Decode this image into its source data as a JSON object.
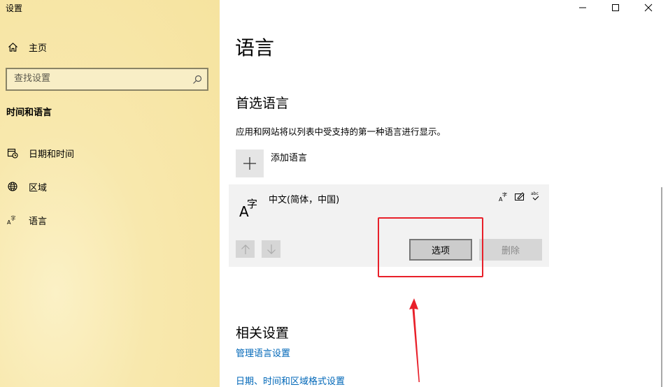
{
  "window": {
    "title": "设置",
    "controls": {
      "minimize": "—",
      "maximize": "☐",
      "close": "✕"
    }
  },
  "sidebar": {
    "home_label": "主页",
    "search_placeholder": "查找设置",
    "section_heading": "时间和语言",
    "items": [
      {
        "label": "日期和时间",
        "icon": "calendar-clock-icon"
      },
      {
        "label": "区域",
        "icon": "globe-icon"
      },
      {
        "label": "语言",
        "icon": "language-icon"
      }
    ]
  },
  "main": {
    "title": "语言",
    "preferred": {
      "heading": "首选语言",
      "description": "应用和网站将以列表中受支持的第一种语言进行显示。",
      "add_label": "添加语言",
      "languages": [
        {
          "name": "中文(简体，中国)",
          "glyph": "A字",
          "features": [
            "display-language-icon",
            "handwriting-icon",
            "spellcheck-icon"
          ],
          "options_label": "选项",
          "remove_label": "删除"
        }
      ]
    },
    "related": {
      "heading": "相关设置",
      "links": [
        "管理语言设置",
        "日期、时间和区域格式设置"
      ]
    }
  },
  "colors": {
    "sidebar_bg": "#f6e39f",
    "link": "#0067b8",
    "highlight": "#e8202a"
  }
}
